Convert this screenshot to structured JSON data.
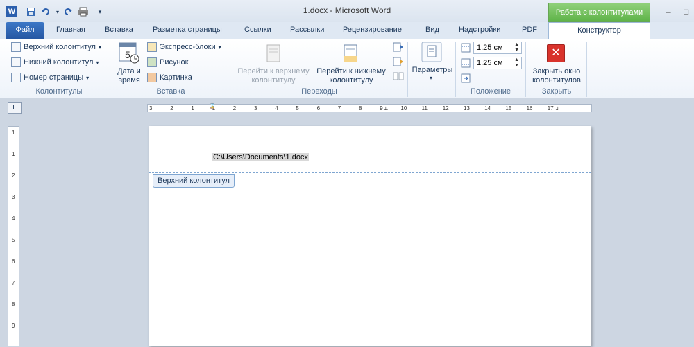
{
  "window": {
    "title": "1.docx  -  Microsoft Word",
    "contextual_group": "Работа с колонтитулами",
    "controls": [
      "–",
      "□"
    ]
  },
  "quick_access": {
    "icons": [
      "word-icon",
      "save-icon",
      "undo-icon",
      "redo-icon",
      "print-icon",
      "customize-icon"
    ]
  },
  "tabs": [
    "Файл",
    "Главная",
    "Вставка",
    "Разметка страницы",
    "Ссылки",
    "Рассылки",
    "Рецензирование",
    "Вид",
    "Надстройки",
    "PDF",
    "Конструктор"
  ],
  "ribbon": {
    "kolontituly": {
      "label": "Колонтитулы",
      "items": [
        "Верхний колонтитул",
        "Нижний колонтитул",
        "Номер страницы"
      ]
    },
    "vstavka": {
      "label": "Вставка",
      "date_time": "Дата и\nвремя",
      "items": [
        "Экспресс-блоки",
        "Рисунок",
        "Картинка"
      ]
    },
    "perehody": {
      "label": "Переходы",
      "goto_header": "Перейти к верхнему\nколонтитулу",
      "goto_footer": "Перейти к нижнему\nколонтитулу"
    },
    "parametry": {
      "label": "Параметры"
    },
    "polozhenie": {
      "label": "Положение",
      "header_pos": "1.25 см",
      "footer_pos": "1.25 см"
    },
    "zakryt": {
      "label": "Закрыть",
      "close_btn": "Закрыть окно\nколонтитулов"
    }
  },
  "ruler": {
    "corner": "L",
    "h_labels": [
      "3",
      "2",
      "1",
      "1",
      "2",
      "3",
      "4",
      "5",
      "6",
      "7",
      "8",
      "9",
      "10",
      "11",
      "12",
      "13",
      "14",
      "15",
      "16",
      "17"
    ],
    "v_labels": [
      "1",
      "1",
      "2",
      "3",
      "4",
      "5",
      "6",
      "7",
      "8",
      "9"
    ]
  },
  "document": {
    "header_text": "C:\\Users\\Documents\\1.docx",
    "header_tag": "Верхний колонтитул"
  },
  "colors": {
    "file_tab": "#2b5fad",
    "contextual_tab": "#5eb348",
    "close_icon": "#d9332c"
  }
}
